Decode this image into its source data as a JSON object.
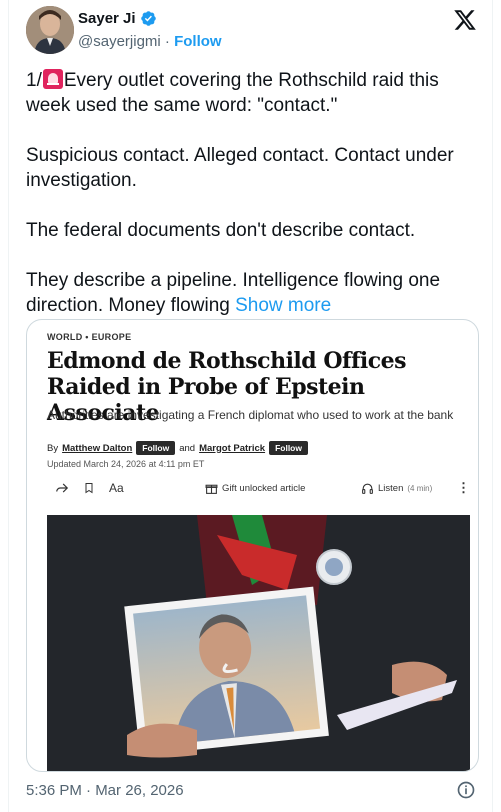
{
  "author": {
    "name": "Sayer Ji",
    "handle": "@sayerjigmi",
    "separator": "·",
    "follow_label": "Follow",
    "verified": true
  },
  "tweet": {
    "prefix": "1/",
    "emoji_icon": "police-car-light-icon",
    "paragraphs": [
      "Every outlet covering the Rothschild raid this week used the same word: \"contact.\"",
      "Suspicious contact. Alleged contact. Contact under investigation.",
      "The federal documents don't describe contact.",
      "They describe a pipeline. Intelligence flowing one direction. Money flowing"
    ],
    "show_more_label": "Show more"
  },
  "article_card": {
    "section": "WORLD",
    "subsection": "EUROPE",
    "headline": "Edmond de Rothschild Offices Raided in Probe of Epstein Associate",
    "dek": "Authorities are investigating a French diplomat who used to work at the bank",
    "by": "By",
    "author1": "Matthew Dalton",
    "and": "and",
    "author2": "Margot Patrick",
    "follow_pill": "Follow",
    "updated": "Updated March 24, 2026 at 4:11 pm ET",
    "toolbar": {
      "font_label": "Aa",
      "gift_label": "Gift unlocked article",
      "listen_label": "Listen",
      "listen_duration": "(4 min)"
    }
  },
  "footer": {
    "timestamp": "5:36 PM · Mar 26, 2026"
  },
  "colors": {
    "accent": "#1d9bf0",
    "text": "#0f1419",
    "muted": "#536471",
    "border": "#cfd9de",
    "emoji_red": "#e0245e"
  }
}
